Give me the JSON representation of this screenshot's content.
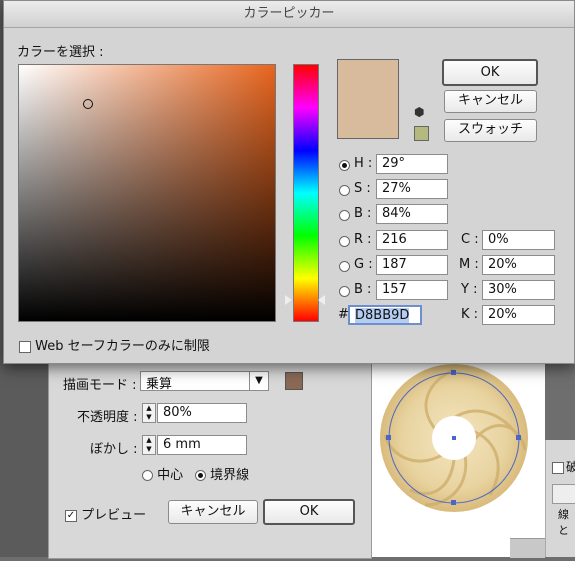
{
  "dialog": {
    "title": "カラーピッカー",
    "select_label": "カラーを選択 :",
    "ok_label": "OK",
    "cancel_label": "キャンセル",
    "swatches_label": "スウォッチ",
    "web_safe_label": "Web セーフカラーのみに制限",
    "web_safe_checked": false,
    "current_color": "#D8BB9D",
    "websafe_color": "#B5B87F",
    "hsb": {
      "h_label": "H :",
      "h_value": "29°",
      "s_label": "S :",
      "s_value": "27%",
      "b_label": "B :",
      "b_value": "84%",
      "selected": "H"
    },
    "rgb": {
      "r_label": "R :",
      "r_value": "216",
      "g_label": "G :",
      "g_value": "187",
      "b_label": "B :",
      "b_value": "157"
    },
    "cmyk": {
      "c_label": "C :",
      "c_value": "0%",
      "m_label": "M :",
      "m_value": "20%",
      "y_label": "Y :",
      "y_value": "30%",
      "k_label": "K :",
      "k_value": "20%"
    },
    "hex_label": "#",
    "hex_value": "D8BB9D"
  },
  "options_panel": {
    "mode_label": "描画モード :",
    "mode_value": "乗算",
    "opacity_label": "不透明度 :",
    "opacity_value": "80%",
    "blur_label": "ぼかし :",
    "blur_value": "6 mm",
    "center_label": "中心",
    "edge_label": "境界線",
    "edge_selected": true,
    "preview_label": "プレビュー",
    "preview_checked": true,
    "cancel_label": "キャンセル",
    "ok_label": "OK",
    "swatch_color": "#8B6A55"
  },
  "right_panel": {
    "label": "破",
    "label2": "線と"
  },
  "colors": {
    "hue_pure": "#E8651E"
  }
}
